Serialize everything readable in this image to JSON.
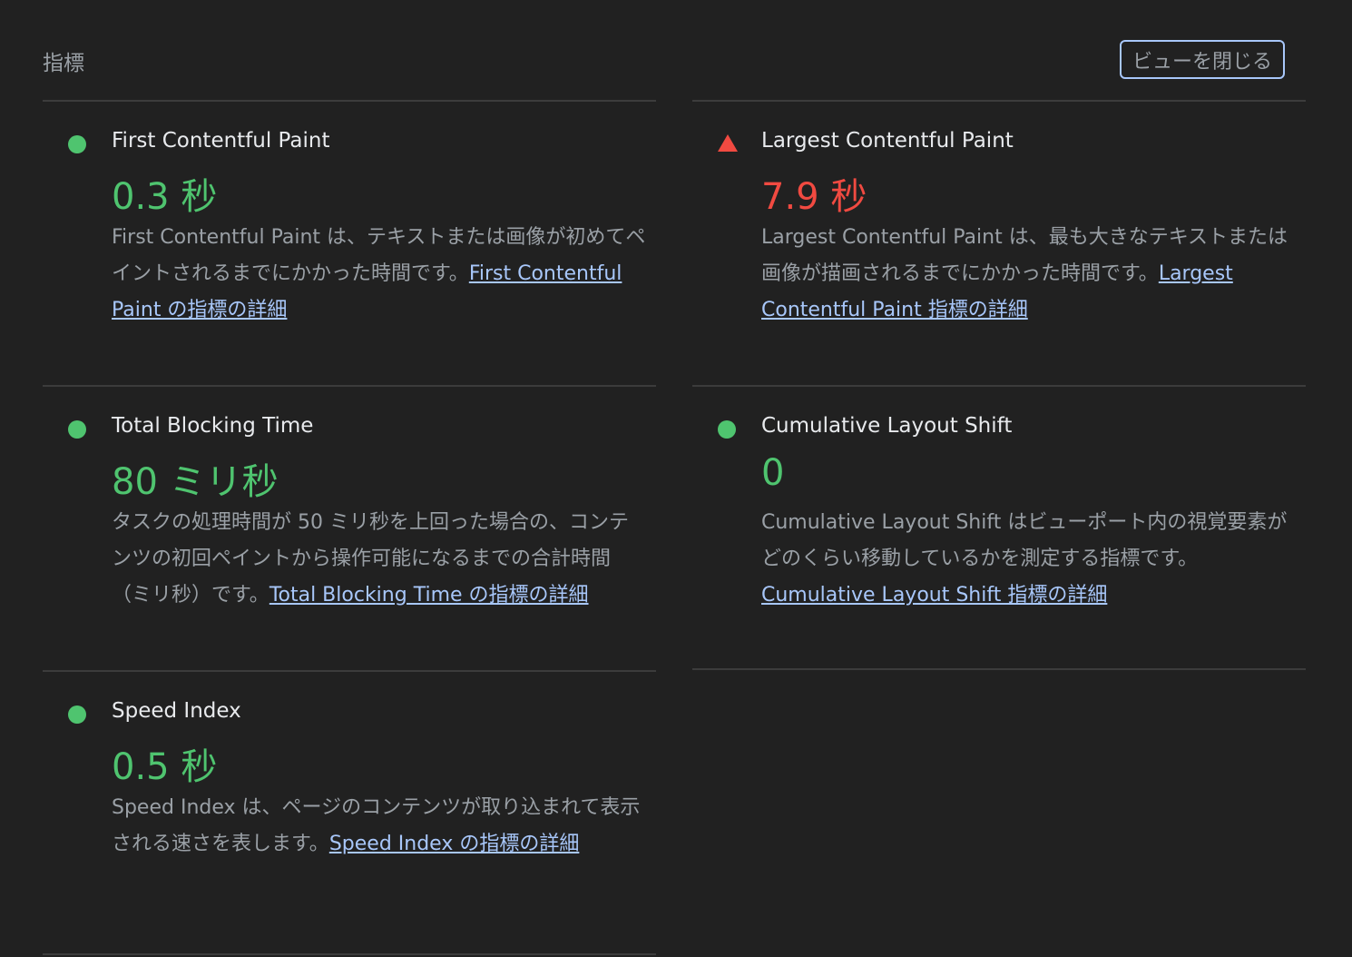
{
  "header": {
    "title": "指標",
    "toggle_label": "ビューを閉じる"
  },
  "colors": {
    "pass": "#4fc46f",
    "fail": "#f14a41",
    "link": "#a8c7fa"
  },
  "metrics": [
    {
      "title": "First Contentful Paint",
      "status": "pass",
      "indicator": "green-circle-icon",
      "value": "0.3 秒",
      "description": "First Contentful Paint は、テキストまたは画像が初めてペイントされるまでにかかった時間です。",
      "link": "First Contentful Paint の指標の詳細"
    },
    {
      "title": "Largest Contentful Paint",
      "status": "fail",
      "indicator": "red-triangle-icon",
      "value": "7.9 秒",
      "description": "Largest Contentful Paint は、最も大きなテキストまたは画像が描画されるまでにかかった時間です。",
      "link": "Largest Contentful Paint 指標の詳細"
    },
    {
      "title": "Total Blocking Time",
      "status": "pass",
      "indicator": "green-circle-icon",
      "value": "80 ミリ秒",
      "description": "タスクの処理時間が 50 ミリ秒を上回った場合の、コンテンツの初回ペイントから操作可能になるまでの合計時間（ミリ秒）です。",
      "link": "Total Blocking Time の指標の詳細"
    },
    {
      "title": "Cumulative Layout Shift",
      "status": "pass",
      "indicator": "green-circle-icon",
      "value": "0",
      "description": "Cumulative Layout Shift はビューポート内の視覚要素がどのくらい移動しているかを測定する指標です。",
      "link": "Cumulative Layout Shift 指標の詳細"
    },
    {
      "title": "Speed Index",
      "status": "pass",
      "indicator": "green-circle-icon",
      "value": "0.5 秒",
      "description": "Speed Index は、ページのコンテンツが取り込まれて表示される速さを表します。",
      "link": "Speed Index の指標の詳細"
    }
  ]
}
